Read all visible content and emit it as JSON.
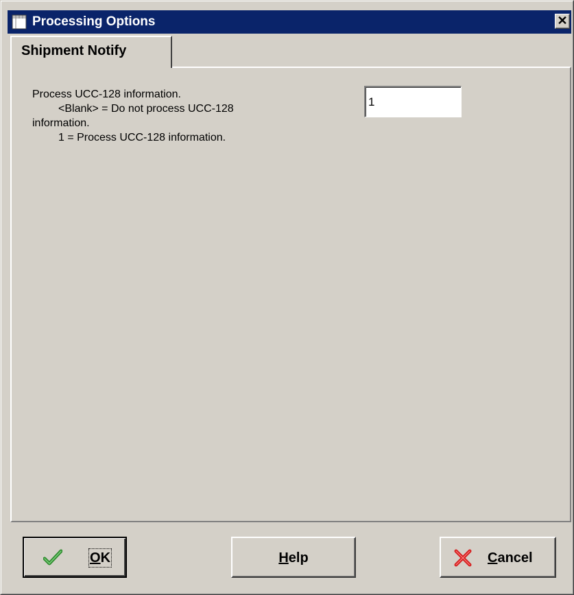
{
  "window": {
    "title": "Processing Options",
    "close_glyph": "✕"
  },
  "tabs": [
    {
      "label": "Shipment Notify",
      "active": true
    }
  ],
  "option": {
    "description": "Process UCC-128 information.",
    "choice_blank": "<Blank> = Do not process UCC-128",
    "choice_blank_wrap": "information.",
    "choice_one": "1 = Process UCC-128 information.",
    "value": "1"
  },
  "buttons": {
    "ok": {
      "mnemonic": "O",
      "rest": "K",
      "icon": "checkmark-icon"
    },
    "help": {
      "mnemonic": "H",
      "rest": "elp"
    },
    "cancel": {
      "mnemonic": "C",
      "rest": "ancel",
      "icon": "red-x-icon"
    }
  },
  "colors": {
    "titlebar": "#0a246a",
    "face": "#d4d0c8",
    "check": "#2e8b2e",
    "cancel_x": "#d42020"
  }
}
